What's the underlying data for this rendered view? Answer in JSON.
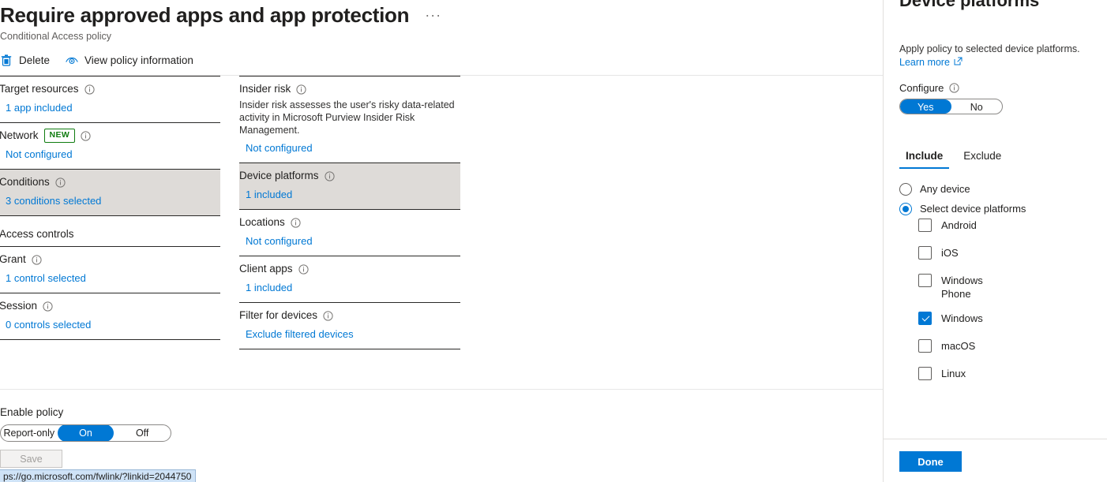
{
  "header": {
    "title": "Require approved apps and app protection",
    "subtitle": "Conditional Access policy",
    "ellipsis": "···",
    "toolbar": [
      {
        "label": "Delete",
        "icon": "trash-icon"
      },
      {
        "label": "View policy information",
        "icon": "eye-icon"
      }
    ]
  },
  "left_column": {
    "sections": [
      {
        "label": "Target resources",
        "info": true,
        "link": "1 app included",
        "highlighted": false
      },
      {
        "label": "Network",
        "badge": "NEW",
        "info": true,
        "link": "Not configured",
        "highlighted": false
      },
      {
        "label": "Conditions",
        "info": true,
        "link": "3 conditions selected",
        "highlighted": true
      }
    ],
    "access_controls_heading": "Access controls",
    "controls": [
      {
        "label": "Grant",
        "info": true,
        "link": "1 control selected"
      },
      {
        "label": "Session",
        "info": true,
        "link": "0 controls selected"
      }
    ]
  },
  "mid_column": {
    "sections": [
      {
        "label": "Insider risk",
        "info": true,
        "description": "Insider risk assesses the user's risky data-related activity in Microsoft Purview Insider Risk Management.",
        "link": "Not configured",
        "highlighted": false
      },
      {
        "label": "Device platforms",
        "info": true,
        "link": "1 included",
        "highlighted": true
      },
      {
        "label": "Locations",
        "info": true,
        "link": "Not configured",
        "highlighted": false
      },
      {
        "label": "Client apps",
        "info": true,
        "link": "1 included",
        "highlighted": false
      },
      {
        "label": "Filter for devices",
        "info": true,
        "link": "Exclude filtered devices",
        "highlighted": false
      }
    ]
  },
  "bottom": {
    "enable_policy_label": "Enable policy",
    "enable_options": [
      "Report-only",
      "On",
      "Off"
    ],
    "enable_selected": "On",
    "save_label": "Save",
    "save_disabled": true,
    "status_url": "ps://go.microsoft.com/fwlink/?linkid=2044750"
  },
  "panel": {
    "title": "Device platforms",
    "description": "Apply policy to selected device platforms.",
    "learn_more": "Learn more",
    "configure_label": "Configure",
    "configure_options": [
      "Yes",
      "No"
    ],
    "configure_selected": "Yes",
    "pivots": [
      {
        "label": "Include",
        "selected": true
      },
      {
        "label": "Exclude",
        "selected": false
      }
    ],
    "radios": [
      {
        "label": "Any device",
        "selected": false
      },
      {
        "label": "Select device platforms",
        "selected": true
      }
    ],
    "checkboxes": [
      {
        "label": "Android",
        "checked": false
      },
      {
        "label": "iOS",
        "checked": false
      },
      {
        "label": "Windows\nPhone",
        "checked": false
      },
      {
        "label": "Windows",
        "checked": true
      },
      {
        "label": "macOS",
        "checked": false
      },
      {
        "label": "Linux",
        "checked": false
      }
    ],
    "done_label": "Done"
  },
  "colors": {
    "accent": "#0078d4",
    "link": "#0078d4",
    "badge_green": "#107c10",
    "highlight_row": "#dedbd8",
    "rule_dark": "#292827"
  }
}
